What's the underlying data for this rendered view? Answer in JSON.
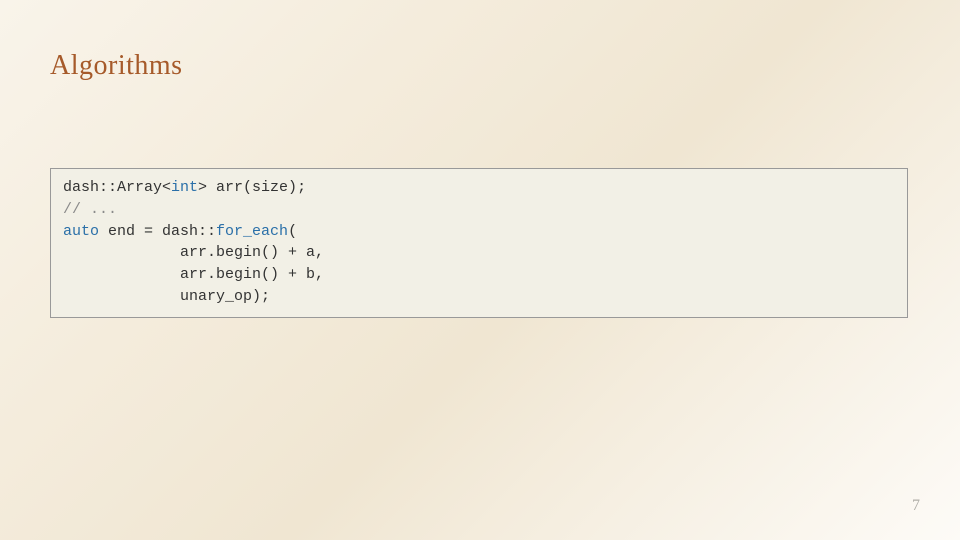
{
  "slide": {
    "title": "Algorithms",
    "page_number": "7"
  },
  "code": {
    "l1a": "dash::Array<",
    "l1_type": "int",
    "l1b": "> arr(size);",
    "l2_comment": "// ...",
    "l3_auto": "auto",
    "l3a": " end = dash::",
    "l3_fn": "for_each",
    "l3b": "(",
    "l4": "             arr.begin() + a,",
    "l5": "             arr.begin() + b,",
    "l6": "             unary_op);"
  }
}
